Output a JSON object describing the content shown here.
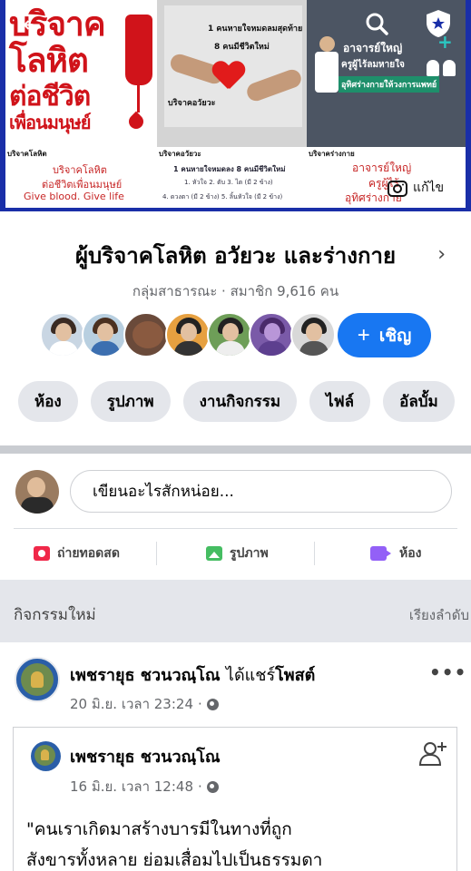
{
  "cover": {
    "panel1": {
      "line1": "บริจาค",
      "line2": "โลหิต",
      "line3": "ต่อชีวิต",
      "line4": "เพื่อนมนุษย์"
    },
    "panel2": {
      "line1": "1 คนหายใจหมดลมสุดท้าย",
      "line2": "8 คนมีชีวิตใหม่",
      "line3": "บริจาคอวัยวะ"
    },
    "panel3": {
      "line1": "อาจารย์ใหญ่",
      "line2": "ครูผู้ไร้ลมหายใจ",
      "line3": "อุทิศร่างกายให้วงการแพทย์"
    },
    "sub1": {
      "caption": "บริจาคโลหิต",
      "l1": "บริจาคโลหิต",
      "l2": "ต่อชีวิตเพื่อนมนุษย์",
      "l3": "Give blood. Give life"
    },
    "sub2": {
      "caption": "บริจาคอวัยวะ",
      "l1": "1 คนหายใจหมดลง 8 คนมีชีวิตใหม่",
      "l2": "1. หัวใจ 2. ตับ 3. ไต (มี 2 ข้าง)",
      "l3": "4. ดวงตา (มี 2 ข้าง) 5. ลิ้นหัวใจ (มี 2 ข้าง)"
    },
    "sub3": {
      "caption": "บริจาคร่างกาย",
      "l1": "อาจารย์ใหญ่",
      "l2": "ครูผู้ไร้",
      "l3": "อุทิศร่างกาย"
    },
    "edit_label": "แก้ไข"
  },
  "group": {
    "title": "ผู้บริจาคโลหิต อวัยวะ และร่างกาย",
    "meta": "กลุ่มสาธารณะ · สมาชิก 9,616 คน",
    "invite_label": "เชิญ"
  },
  "tabs": [
    "ห้อง",
    "รูปภาพ",
    "งานกิจกรรม",
    "ไฟล์",
    "อัลบั้ม"
  ],
  "composer": {
    "placeholder": "เขียนอะไรสักหน่อย...",
    "actions": {
      "live": "ถ่ายทอดสด",
      "photo": "รูปภาพ",
      "room": "ห้อง"
    }
  },
  "activity": {
    "heading": "กิจกรรมใหม่",
    "sort": "เรียงลำดับ"
  },
  "post": {
    "author": "เพชรายุธ ชวนวณฺโณ",
    "action": "ได้แชร์",
    "object": "โพสต์",
    "time": "20 มิ.ย. เวลา 23:24",
    "shared": {
      "author": "เพชรายุธ ชวนวณฺโณ",
      "time": "16 มิ.ย. เวลา 12:48",
      "line1": "\"คนเราเกิดมาสร้างบารมีในทางที่ถูก",
      "line2": "สังขารทั้งหลาย ย่อมเสื่อมไปเป็นธรรมดา"
    }
  },
  "colors": {
    "accent": "#1877f2",
    "cover_border": "#1a2fa8",
    "blood_red": "#d0131a"
  }
}
